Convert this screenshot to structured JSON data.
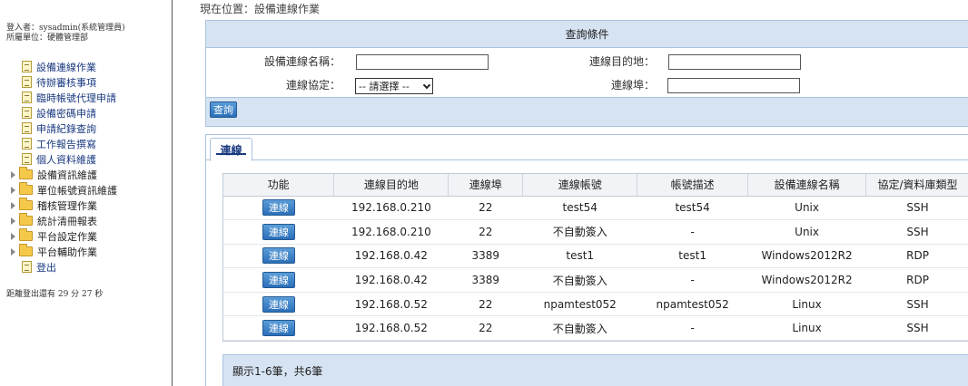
{
  "sidebar": {
    "login_user": "登入者：sysadmin(系統管理員)",
    "login_unit": "所屬單位：硬體管理部",
    "items": [
      {
        "label": "設備連線作業",
        "type": "leaf"
      },
      {
        "label": "待辦審核事項",
        "type": "leaf"
      },
      {
        "label": "臨時帳號代理申請",
        "type": "leaf"
      },
      {
        "label": "設備密碼申請",
        "type": "leaf"
      },
      {
        "label": "申請紀錄查詢",
        "type": "leaf"
      },
      {
        "label": "工作報告撰寫",
        "type": "leaf"
      },
      {
        "label": "個人資料維護",
        "type": "leaf"
      },
      {
        "label": "設備資訊維護",
        "type": "folder"
      },
      {
        "label": "單位帳號資訊維護",
        "type": "folder"
      },
      {
        "label": "稽核管理作業",
        "type": "folder"
      },
      {
        "label": "統計清冊報表",
        "type": "folder"
      },
      {
        "label": "平台設定作業",
        "type": "folder"
      },
      {
        "label": "平台輔助作業",
        "type": "folder"
      },
      {
        "label": "登出",
        "type": "leaf"
      }
    ],
    "countdown": "距離登出還有 29 分 27 秒"
  },
  "location": "現在位置：設備連線作業",
  "query": {
    "header": "查詢條件",
    "device_name_label": "設備連線名稱：",
    "device_name_value": "",
    "destination_label": "連線目的地：",
    "destination_value": "",
    "protocol_label": "連線協定：",
    "protocol_selected": "-- 請選擇 --",
    "port_label": "連線埠：",
    "port_value": "",
    "search_button": "查詢"
  },
  "results": {
    "tab_label": "連線",
    "columns": [
      "功能",
      "連線目的地",
      "連線埠",
      "連線帳號",
      "帳號描述",
      "設備連線名稱",
      "協定/資料庫類型"
    ],
    "connect_label": "連線",
    "rows": [
      [
        "192.168.0.210",
        "22",
        "test54",
        "test54",
        "Unix",
        "SSH"
      ],
      [
        "192.168.0.210",
        "22",
        "不自動簽入",
        "-",
        "Unix",
        "SSH"
      ],
      [
        "192.168.0.42",
        "3389",
        "test1",
        "test1",
        "Windows2012R2",
        "RDP"
      ],
      [
        "192.168.0.42",
        "3389",
        "不自動簽入",
        "-",
        "Windows2012R2",
        "RDP"
      ],
      [
        "192.168.0.52",
        "22",
        "npamtest052",
        "npamtest052",
        "Linux",
        "SSH"
      ],
      [
        "192.168.0.52",
        "22",
        "不自動簽入",
        "-",
        "Linux",
        "SSH"
      ]
    ],
    "footer": "顯示1-6筆，共6筆"
  }
}
